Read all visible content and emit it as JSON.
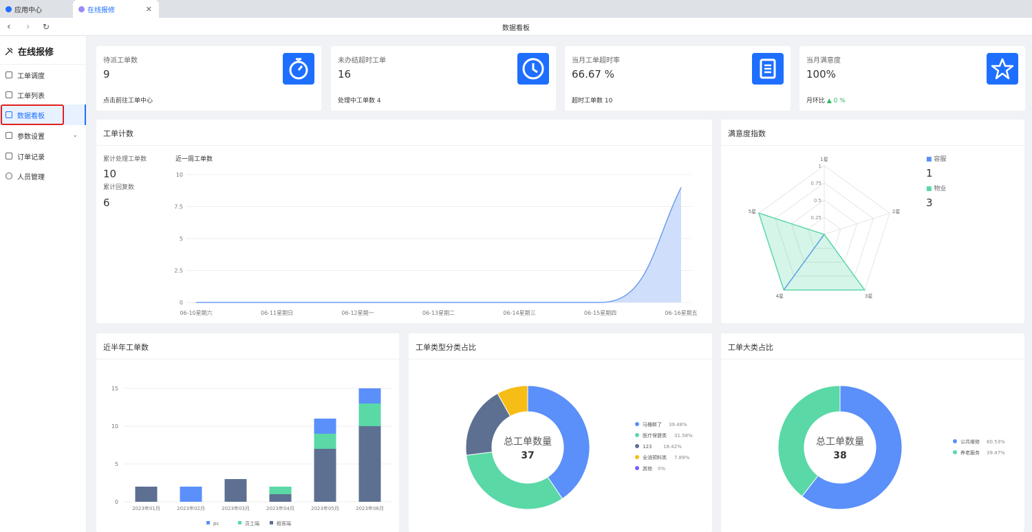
{
  "browser": {
    "tabs": [
      {
        "label": "应用中心"
      },
      {
        "label": "在线报修"
      }
    ],
    "page_title": "数据看板"
  },
  "sidebar": {
    "brand": "在线报修",
    "items": [
      {
        "label": "工单调度"
      },
      {
        "label": "工单列表"
      },
      {
        "label": "数据看板"
      },
      {
        "label": "参数设置"
      },
      {
        "label": "订单记录"
      },
      {
        "label": "人员管理"
      }
    ]
  },
  "stats": [
    {
      "label": "待派工单数",
      "value": "9",
      "foot": "点击前往工单中心",
      "icon": "stopwatch-icon"
    },
    {
      "label": "未办结超时工单",
      "value": "16",
      "foot": "处理中工单数 4",
      "icon": "clock-icon"
    },
    {
      "label": "当月工单超时率",
      "value": "66.67 %",
      "foot": "超时工单数 10",
      "icon": "clipboard-icon"
    },
    {
      "label": "当月满意度",
      "value": "100%",
      "foot": "月环比",
      "foot_trend": "▲ 0 %",
      "icon": "star-icon"
    }
  ],
  "workorder": {
    "title": "工单计数",
    "total_label": "累计处理工单数",
    "total_value": "10",
    "reply_label": "累计回复数",
    "reply_value": "6",
    "chart_title": "近一周工单数"
  },
  "satisfaction": {
    "title": "满意度指数",
    "legend": [
      {
        "name": "容服",
        "value": "1"
      },
      {
        "name": "物业",
        "value": "3"
      }
    ]
  },
  "halfyear": {
    "title": "近半年工单数"
  },
  "type_ratio": {
    "title": "工单类型分类占比",
    "center_label": "总工单数量",
    "center_value": "37"
  },
  "category_ratio": {
    "title": "工单大类占比",
    "center_label": "总工单数量",
    "center_value": "38"
  },
  "colors": {
    "primary": "#1e6fff",
    "blue": "#5b8ff9",
    "green": "#5ad8a6",
    "slate": "#5d7092",
    "yellow": "#f6bd16",
    "purple": "#7262fd"
  },
  "chart_data": [
    {
      "type": "area",
      "title": "近一周工单数",
      "categories": [
        "06-10星期六",
        "06-11星期日",
        "06-12星期一",
        "06-13星期二",
        "06-14星期三",
        "06-15星期四",
        "06-16星期五"
      ],
      "values": [
        0,
        0,
        0,
        0,
        0,
        0,
        9
      ],
      "yticks": [
        0,
        2.5,
        5,
        7.5,
        10
      ],
      "ylim": [
        0,
        10
      ],
      "color": "#6f9df0"
    },
    {
      "type": "radar",
      "title": "满意度指数",
      "axes": [
        "1星",
        "2星",
        "3星",
        "4星",
        "5星"
      ],
      "ticks": [
        0.25,
        0.5,
        0.75,
        1
      ],
      "max": 1,
      "series": [
        {
          "name": "容服",
          "values": [
            0,
            0,
            0,
            1,
            0
          ],
          "color": "#5b8ff9"
        },
        {
          "name": "物业",
          "values": [
            0,
            0,
            1,
            1,
            1
          ],
          "color": "#5ad8a6"
        }
      ]
    },
    {
      "type": "bar",
      "stacked": true,
      "title": "近半年工单数",
      "categories": [
        "2023年01月",
        "2023年02月",
        "2023年03月",
        "2023年04月",
        "2023年05月",
        "2023年06月"
      ],
      "ylim": [
        0,
        15
      ],
      "yticks": [
        0,
        5,
        10,
        15
      ],
      "series": [
        {
          "name": "租客端",
          "values": [
            2,
            0,
            3,
            1,
            7,
            10
          ],
          "color": "#5d7092"
        },
        {
          "name": "员工端",
          "values": [
            0,
            0,
            0,
            1,
            2,
            3
          ],
          "color": "#5ad8a6"
        },
        {
          "name": "pc",
          "values": [
            0,
            2,
            0,
            0,
            2,
            2
          ],
          "color": "#5b8ff9"
        }
      ],
      "legend": [
        "pc",
        "员工端",
        "租客端"
      ]
    },
    {
      "type": "pie",
      "title": "工单类型分类占比",
      "slices": [
        {
          "name": "马桶断了",
          "label": "39.48%",
          "value": 39.48,
          "color": "#5b8ff9"
        },
        {
          "name": "医疗保健类",
          "label": "31.58%",
          "value": 31.58,
          "color": "#5ad8a6"
        },
        {
          "name": "123",
          "label": "18.42%",
          "value": 18.42,
          "color": "#5d7092"
        },
        {
          "name": "全消预料类",
          "label": "7.89%",
          "value": 7.89,
          "color": "#f6bd16"
        },
        {
          "name": "其他",
          "label": "0%",
          "value": 0,
          "color": "#7262fd"
        }
      ]
    },
    {
      "type": "pie",
      "title": "工单大类占比",
      "slices": [
        {
          "name": "公共维修",
          "label": "60.53%",
          "value": 60.53,
          "color": "#5b8ff9"
        },
        {
          "name": "养老服务",
          "label": "39.47%",
          "value": 39.47,
          "color": "#5ad8a6"
        }
      ]
    }
  ]
}
